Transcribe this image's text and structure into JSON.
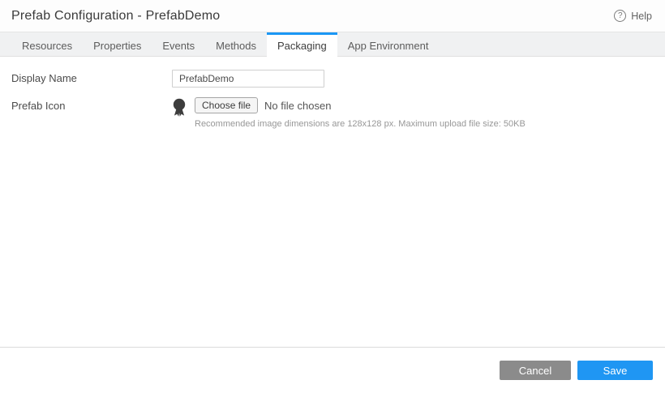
{
  "header": {
    "title": "Prefab Configuration - PrefabDemo",
    "help_label": "Help",
    "help_icon_glyph": "?"
  },
  "tabs": [
    {
      "label": "Resources",
      "active": false
    },
    {
      "label": "Properties",
      "active": false
    },
    {
      "label": "Events",
      "active": false
    },
    {
      "label": "Methods",
      "active": false
    },
    {
      "label": "Packaging",
      "active": true
    },
    {
      "label": "App Environment",
      "active": false
    }
  ],
  "form": {
    "display_name": {
      "label": "Display Name",
      "value": "PrefabDemo"
    },
    "prefab_icon": {
      "label": "Prefab Icon",
      "icon_name": "award-ribbon-icon",
      "choose_file_label": "Choose file",
      "no_file_text": "No file chosen",
      "hint": "Recommended image dimensions are 128x128 px. Maximum upload file size: 50KB"
    }
  },
  "footer": {
    "cancel_label": "Cancel",
    "save_label": "Save"
  },
  "colors": {
    "accent_blue": "#1f96f3",
    "cancel_gray": "#8b8b8b",
    "tabbar_bg": "#f0f1f2"
  }
}
